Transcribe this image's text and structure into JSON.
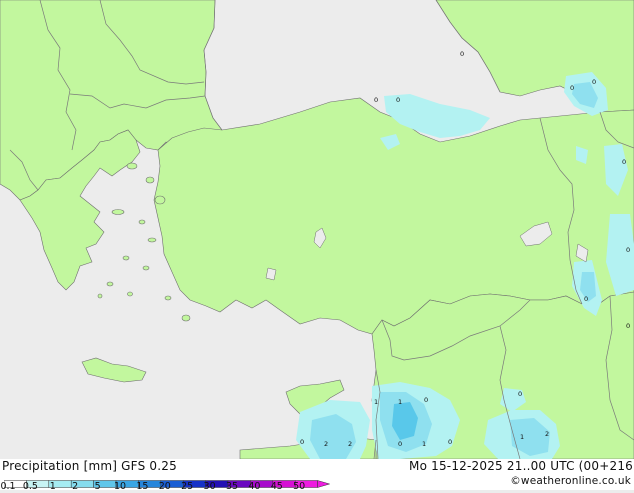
{
  "map": {
    "colors": {
      "sea": "#ececec",
      "land": "#c2f79e",
      "border": "#7a7a7a",
      "coast": "#6f6f6f",
      "precip_light": "#b3f2f2",
      "precip_med": "#8fe0ef",
      "precip_heavy": "#59c8ea"
    },
    "cell_values": [
      {
        "id": "v1",
        "text": "0"
      },
      {
        "id": "v2",
        "text": "0"
      },
      {
        "id": "v3",
        "text": "0"
      },
      {
        "id": "v4",
        "text": "0"
      },
      {
        "id": "v5",
        "text": "0"
      },
      {
        "id": "v6",
        "text": "0"
      },
      {
        "id": "v7",
        "text": "0"
      },
      {
        "id": "v8",
        "text": "0"
      },
      {
        "id": "v9",
        "text": "0"
      },
      {
        "id": "v10",
        "text": "1"
      },
      {
        "id": "v11",
        "text": "1"
      },
      {
        "id": "v12",
        "text": "0"
      },
      {
        "id": "v13",
        "text": "0"
      },
      {
        "id": "v14",
        "text": "1"
      },
      {
        "id": "v15",
        "text": "0"
      },
      {
        "id": "v16",
        "text": "0"
      },
      {
        "id": "v17",
        "text": "2"
      },
      {
        "id": "v18",
        "text": "2"
      },
      {
        "id": "v19",
        "text": "1"
      },
      {
        "id": "v20",
        "text": "2"
      },
      {
        "id": "v21",
        "text": "0"
      }
    ]
  },
  "footer": {
    "title": "Precipitation [mm]  GFS 0.25",
    "valid_time": "Mo 15-12-2025 21..00 UTC (00+216",
    "credit": "©weatheronline.co.uk"
  },
  "legend": {
    "ticks": [
      "0.1",
      "0.5",
      "1",
      "2",
      "5",
      "10",
      "15",
      "20",
      "25",
      "30",
      "35",
      "40",
      "45",
      "50"
    ],
    "colors": [
      "#ffffff",
      "#c8f4f4",
      "#a6ecf2",
      "#86dcee",
      "#5fc6ea",
      "#3aa6e4",
      "#2686dc",
      "#1a5ed4",
      "#1632c8",
      "#2410b4",
      "#6a08c0",
      "#a80ccc",
      "#d610d4",
      "#ee1ce0"
    ]
  }
}
